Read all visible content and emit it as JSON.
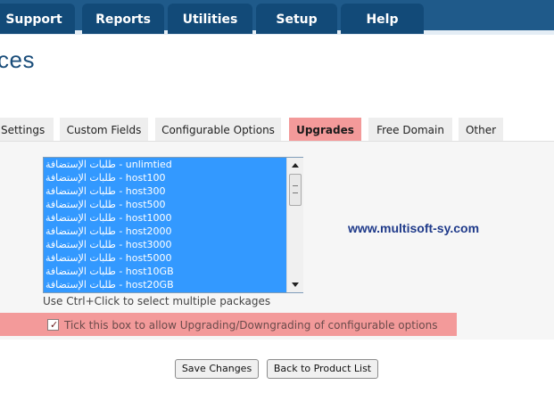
{
  "nav": {
    "tabs": [
      {
        "label": "Support"
      },
      {
        "label": "Reports"
      },
      {
        "label": "Utilities"
      },
      {
        "label": "Setup"
      },
      {
        "label": "Help"
      }
    ]
  },
  "page": {
    "title": "ces"
  },
  "subtabs": [
    {
      "label": "e Settings"
    },
    {
      "label": "Custom Fields"
    },
    {
      "label": "Configurable Options"
    },
    {
      "label": "Upgrades"
    },
    {
      "label": "Free Domain"
    },
    {
      "label": "Other"
    }
  ],
  "packages": {
    "items": [
      "طلبات الإستضافة - unlimtied",
      "طلبات الإستضافة - host100",
      "طلبات الإستضافة - host300",
      "طلبات الإستضافة - host500",
      "طلبات الإستضافة - host1000",
      "طلبات الإستضافة - host2000",
      "طلبات الإستضافة - host3000",
      "طلبات الإستضافة - host5000",
      "طلبات الإستضافة - host10GB",
      "طلبات الإستضافة - host20GB"
    ],
    "hint": "Use Ctrl+Click to select multiple packages"
  },
  "watermark": "www.multisoft-sy.com",
  "configurable": {
    "checked": true,
    "label": "Tick this box to allow Upgrading/Downgrading of configurable options"
  },
  "actions": {
    "save_label": "Save Changes",
    "back_label": "Back to Product List"
  },
  "colors": {
    "nav_bar": "#1f5a8a",
    "nav_tab": "#124a78",
    "active_highlight": "#f39a9a",
    "list_selection": "#3399ff"
  }
}
